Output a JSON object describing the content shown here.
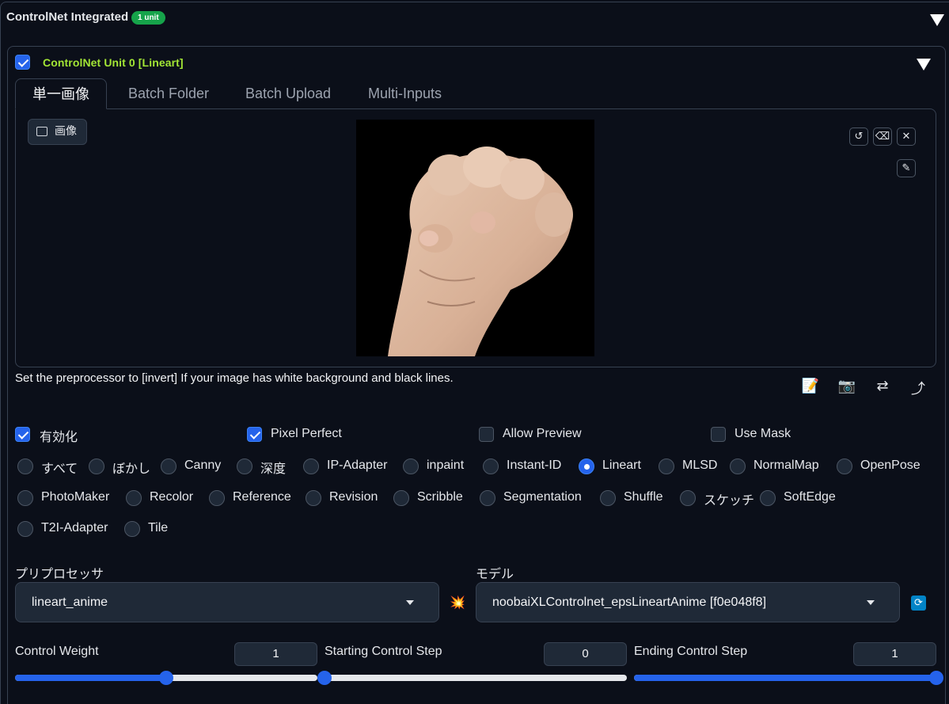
{
  "accordion": {
    "title": "ControlNet Integrated",
    "badge": "1 unit"
  },
  "unit": {
    "title": "ControlNet Unit 0  [Lineart]",
    "enabled_checkbox": true,
    "tabs": [
      {
        "label": "単一画像",
        "active": true
      },
      {
        "label": "Batch Folder",
        "active": false
      },
      {
        "label": "Batch Upload",
        "active": false
      },
      {
        "label": "Multi-Inputs",
        "active": false
      }
    ],
    "image_label": "画像",
    "image_icon": "image-icon",
    "image_tools": [
      "undo-icon",
      "eraser-icon",
      "close-icon",
      "brush-icon"
    ],
    "hint": "Set the preprocessor to [invert] If your image has white background and black lines.",
    "tool_icons": [
      "📝",
      "📷",
      "⇄",
      "⤴"
    ],
    "checkboxes": [
      {
        "label": "有効化",
        "checked": true
      },
      {
        "label": "Pixel Perfect",
        "checked": true
      },
      {
        "label": "Allow Preview",
        "checked": false
      },
      {
        "label": "Use Mask",
        "checked": false
      }
    ],
    "control_types": [
      "すべて",
      "ぼかし",
      "Canny",
      "深度",
      "IP-Adapter",
      "inpaint",
      "Instant-ID",
      "Lineart",
      "MLSD",
      "NormalMap",
      "OpenPose",
      "PhotoMaker",
      "Recolor",
      "Reference",
      "Revision",
      "Scribble",
      "Segmentation",
      "Shuffle",
      "スケッチ",
      "SoftEdge",
      "T2I-Adapter",
      "Tile"
    ],
    "selected_control_type": "Lineart",
    "preprocessor": {
      "label": "プリプロセッサ",
      "value": "lineart_anime"
    },
    "run_preprocessor_icon": "💥",
    "model": {
      "label": "モデル",
      "value": "noobaiXLControlnet_epsLineartAnime [f0e048f8]"
    },
    "refresh_icon": "⟳",
    "sliders": [
      {
        "label": "Control Weight",
        "value": "1",
        "fraction": 0.5
      },
      {
        "label": "Starting Control Step",
        "value": "0",
        "fraction": 0.0
      },
      {
        "label": "Ending Control Step",
        "value": "1",
        "fraction": 1.0
      }
    ]
  }
}
